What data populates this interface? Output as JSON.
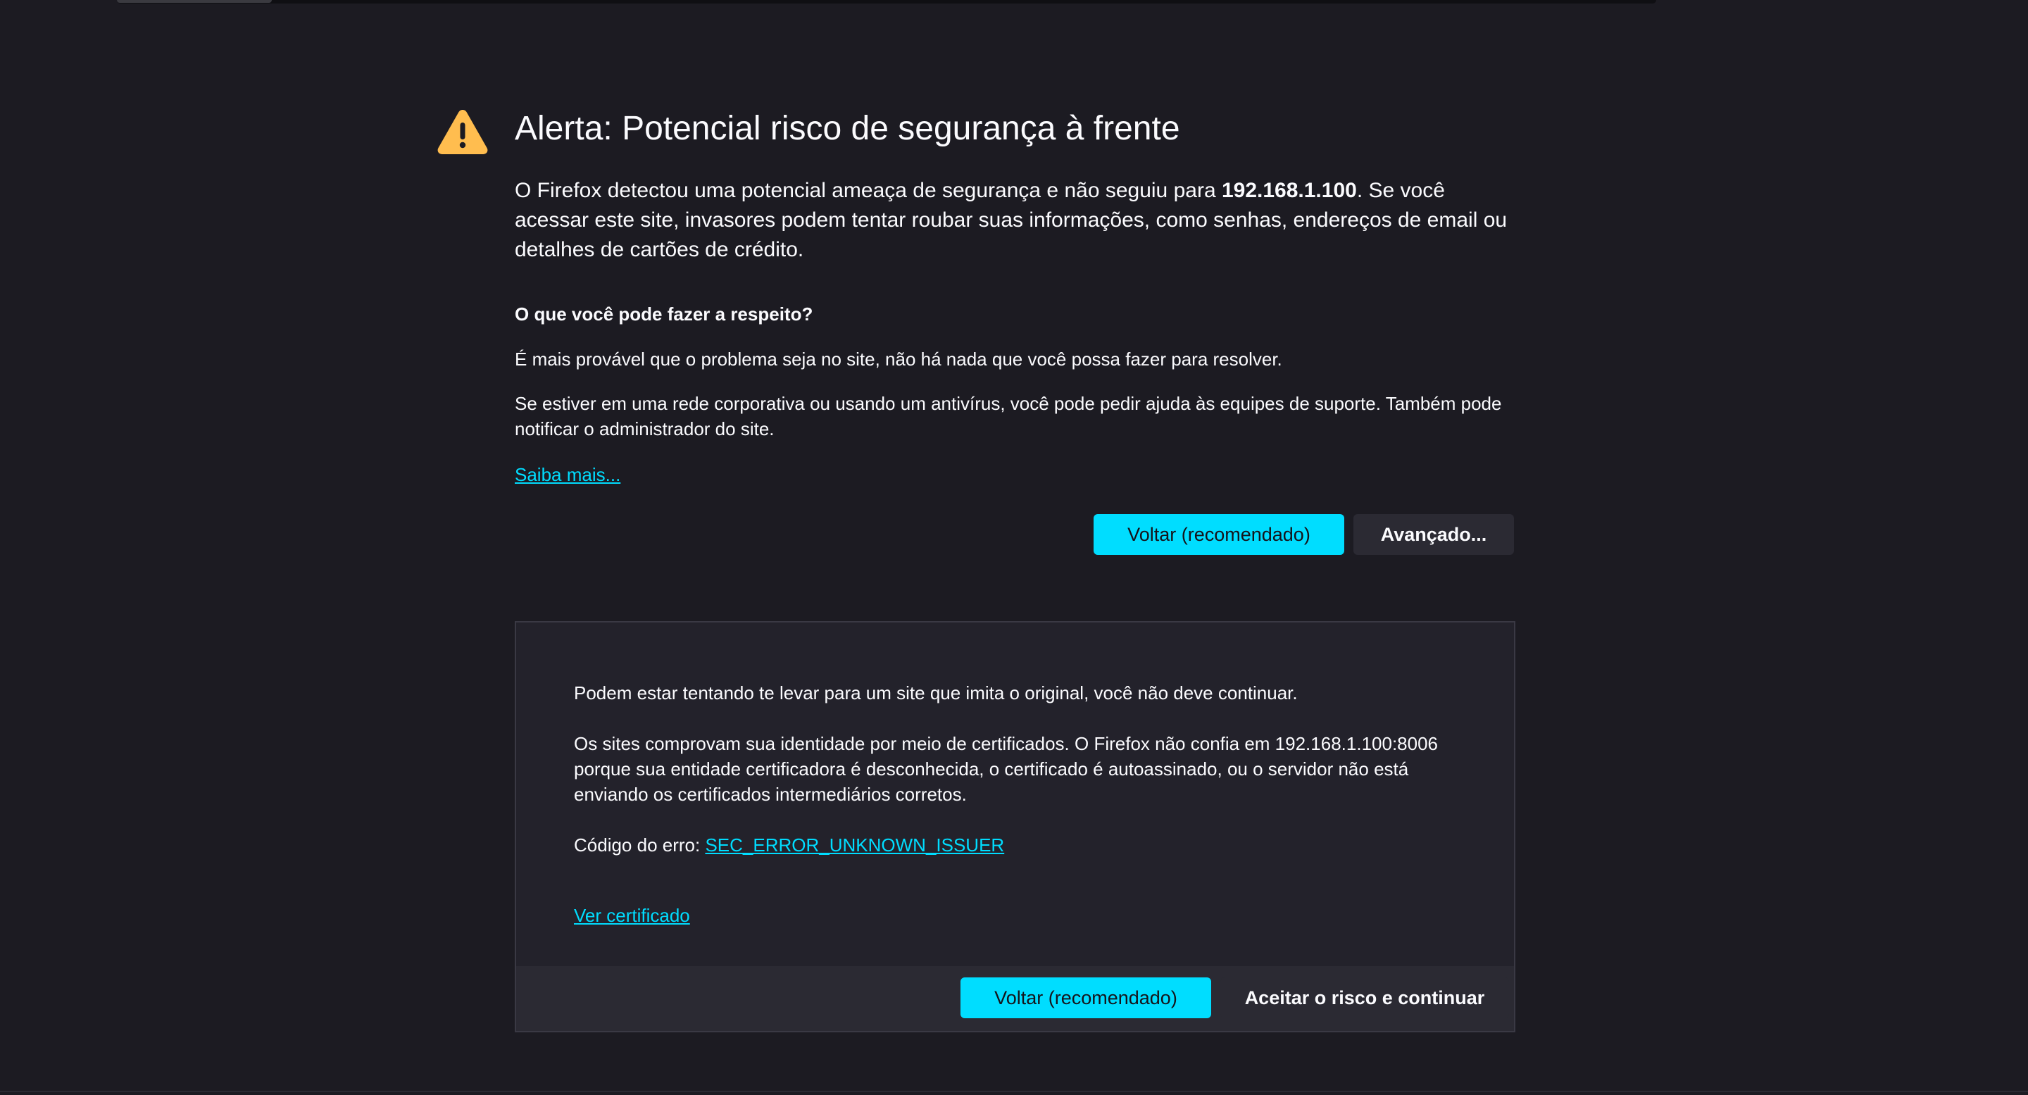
{
  "page": {
    "title": "Alerta: Potencial risco de segurança à frente",
    "intro_before": "O Firefox detectou uma potencial ameaça de segurança e não seguiu para ",
    "host": "192.168.1.100",
    "intro_after": ". Se você acessar este site, invasores podem tentar roubar suas informações, como senhas, endereços de email ou detalhes de cartões de crédito.",
    "what_heading": "O que você pode fazer a respeito?",
    "what_p1": "É mais provável que o problema seja no site, não há nada que você possa fazer para resolver.",
    "what_p2": "Se estiver em uma rede corporativa ou usando um antivírus, você pode pedir ajuda às equipes de suporte. Também pode notificar o administrador do site.",
    "learn_more": "Saiba mais...",
    "back_button": "Voltar (recomendado)",
    "advanced_button": "Avançado..."
  },
  "advanced": {
    "p1": "Podem estar tentando te levar para um site que imita o original, você não deve continuar.",
    "p2": "Os sites comprovam sua identidade por meio de certificados. O Firefox não confia em 192.168.1.100:8006 porque sua entidade certificadora é desconhecida, o certificado é autoassinado, ou o servidor não está enviando os certificados intermediários corretos.",
    "code_label": "Código do erro: ",
    "code": "SEC_ERROR_UNKNOWN_ISSUER",
    "view_cert": "Ver certificado",
    "back_button": "Voltar (recomendado)",
    "accept_button": "Aceitar o risco e continuar"
  },
  "icons": {
    "warning": "warning-triangle-icon"
  },
  "colors": {
    "background": "#1c1b22",
    "accent": "#00ddff",
    "warning": "#ffbd4f",
    "text": "#fbfbfe"
  }
}
